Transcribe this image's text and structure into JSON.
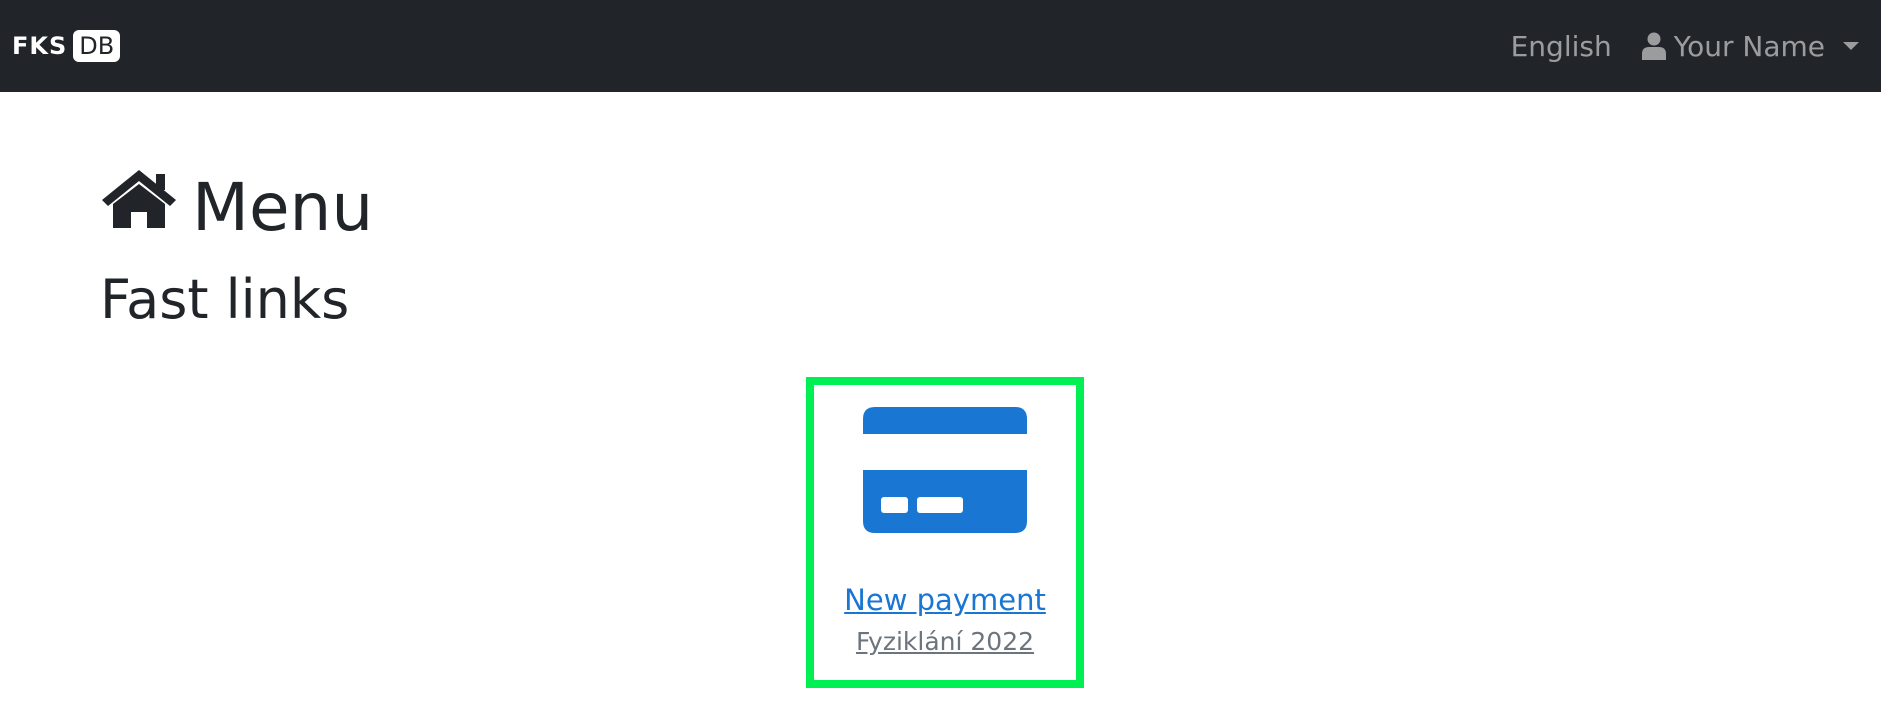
{
  "navbar": {
    "brand_fks": "FKS",
    "brand_db": "DB",
    "language": "English",
    "user_name": "Your Name"
  },
  "main": {
    "title": "Menu",
    "section_title": "Fast links",
    "fast_links": [
      {
        "label": "New payment",
        "sublabel": "Fyziklání 2022",
        "icon": "credit-card-icon"
      }
    ]
  },
  "colors": {
    "navbar_bg": "#212529",
    "link": "#1976d2",
    "highlight": "#00ef53"
  }
}
